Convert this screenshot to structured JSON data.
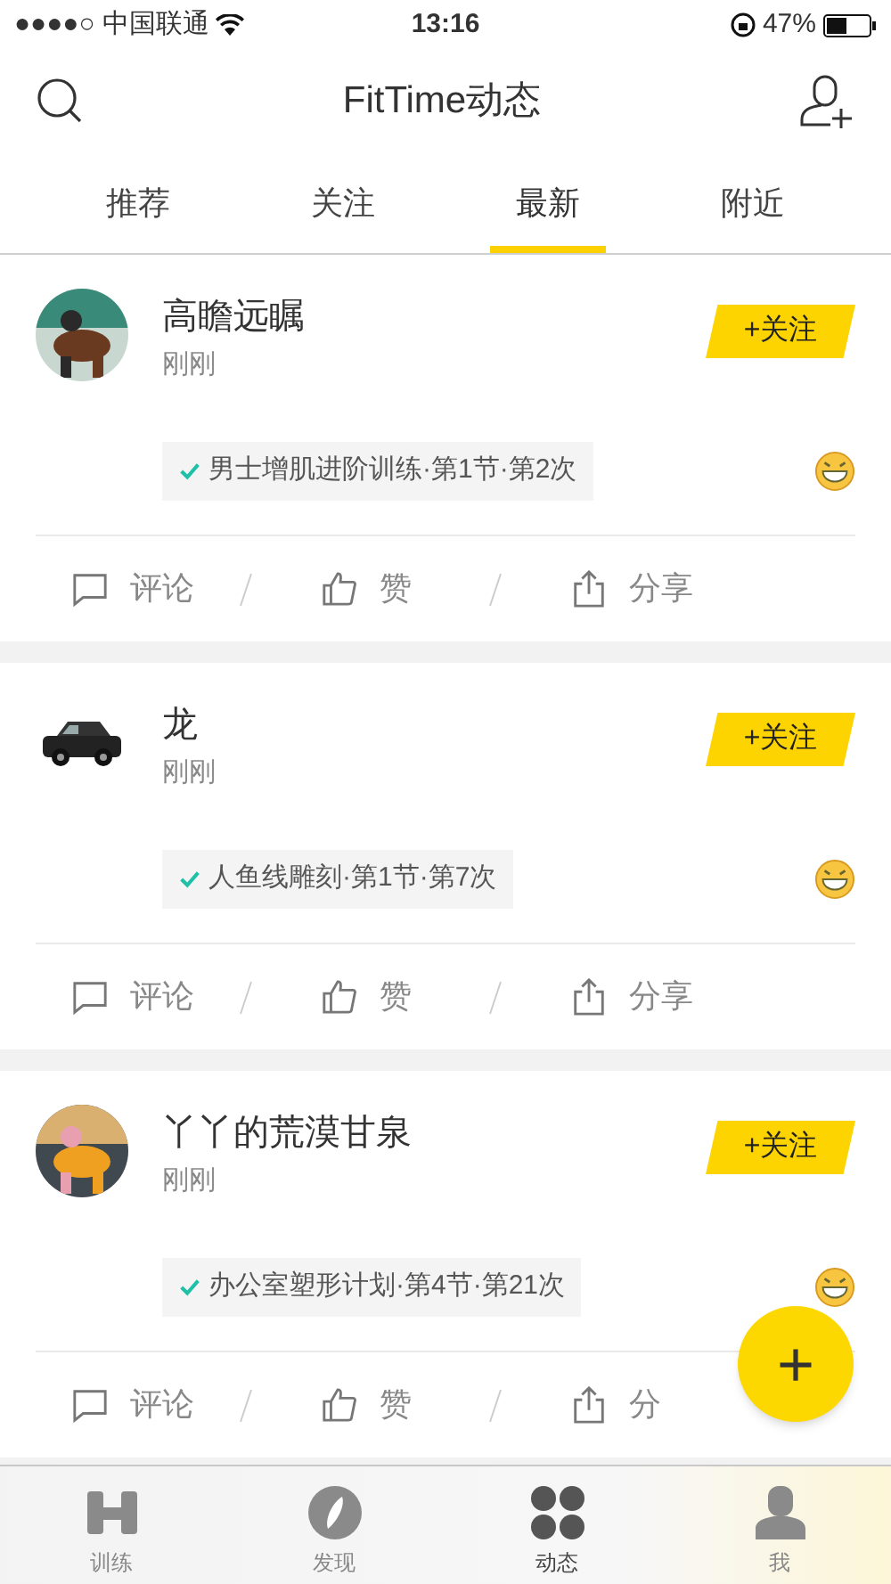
{
  "status_bar": {
    "carrier": "●●●●○ 中国联通",
    "time": "13:16",
    "battery": "47%"
  },
  "header": {
    "title": "FitTime动态"
  },
  "tabs": [
    {
      "label": "推荐",
      "selected": false
    },
    {
      "label": "关注",
      "selected": false
    },
    {
      "label": "最新",
      "selected": true
    },
    {
      "label": "附近",
      "selected": false
    }
  ],
  "posts": [
    {
      "name": "高瞻远瞩",
      "time": "刚刚",
      "follow": "+关注",
      "tag": "男士增肌进阶训练·第1节·第2次",
      "actions": [
        "评论",
        "赞",
        "分享"
      ]
    },
    {
      "name": "龙",
      "time": "刚刚",
      "follow": "+关注",
      "tag": "人鱼线雕刻·第1节·第7次",
      "actions": [
        "评论",
        "赞",
        "分享"
      ]
    },
    {
      "name": "丫丫的荒漠甘泉",
      "time": "刚刚",
      "follow": "+关注",
      "tag": "办公室塑形计划·第4节·第21次",
      "actions": [
        "评论",
        "赞",
        "分"
      ]
    }
  ],
  "fab": {
    "label": "+"
  },
  "bottom_nav": [
    {
      "label": "训练",
      "kind": "dumbbell",
      "selected": false
    },
    {
      "label": "发现",
      "kind": "compass",
      "selected": false
    },
    {
      "label": "动态",
      "kind": "dots",
      "selected": true
    },
    {
      "label": "我",
      "kind": "person",
      "selected": false
    }
  ]
}
